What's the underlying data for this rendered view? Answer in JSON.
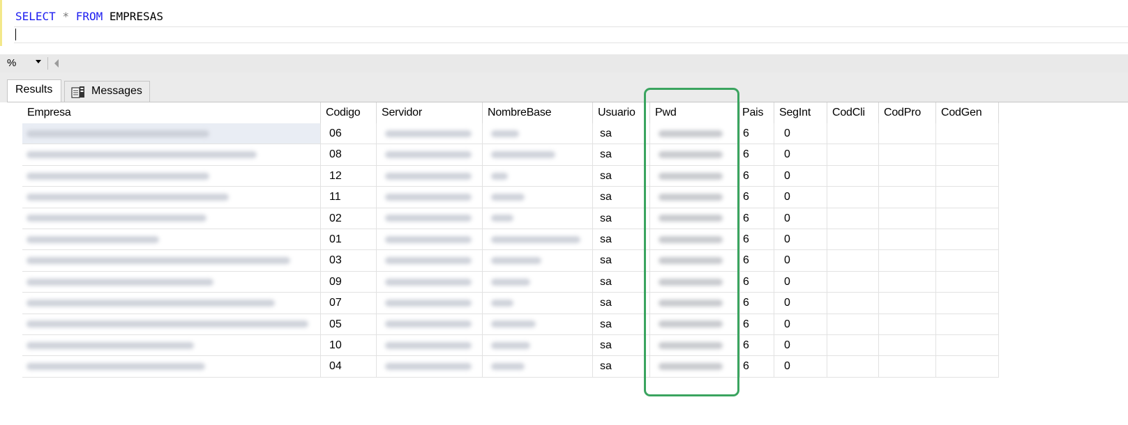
{
  "editor": {
    "keyword_select": "SELECT",
    "star": "*",
    "keyword_from": "FROM",
    "table_name": "EMPRESAS"
  },
  "zoom": {
    "value": "%"
  },
  "tabs": [
    {
      "label": "Results"
    },
    {
      "label": "Messages"
    }
  ],
  "grid": {
    "columns": [
      "Empresa",
      "Codigo",
      "Servidor",
      "NombreBase",
      "Usuario",
      "Pwd",
      "Pais",
      "SegInt",
      "CodCli",
      "CodPro",
      "CodGen"
    ],
    "rows": [
      {
        "codigo": "06",
        "usuario": "sa",
        "pais": "6",
        "segint": "0",
        "blur_w": [
          262,
          124,
          40
        ]
      },
      {
        "codigo": "08",
        "usuario": "sa",
        "pais": "6",
        "segint": "0",
        "blur_w": [
          330,
          124,
          92
        ]
      },
      {
        "codigo": "12",
        "usuario": "sa",
        "pais": "6",
        "segint": "0",
        "blur_w": [
          262,
          124,
          24
        ]
      },
      {
        "codigo": "11",
        "usuario": "sa",
        "pais": "6",
        "segint": "0",
        "blur_w": [
          290,
          124,
          48
        ]
      },
      {
        "codigo": "02",
        "usuario": "sa",
        "pais": "6",
        "segint": "0",
        "blur_w": [
          258,
          124,
          32
        ]
      },
      {
        "codigo": "01",
        "usuario": "sa",
        "pais": "6",
        "segint": "0",
        "blur_w": [
          190,
          124,
          128
        ]
      },
      {
        "codigo": "03",
        "usuario": "sa",
        "pais": "6",
        "segint": "0",
        "blur_w": [
          378,
          124,
          72
        ]
      },
      {
        "codigo": "09",
        "usuario": "sa",
        "pais": "6",
        "segint": "0",
        "blur_w": [
          268,
          124,
          56
        ]
      },
      {
        "codigo": "07",
        "usuario": "sa",
        "pais": "6",
        "segint": "0",
        "blur_w": [
          356,
          124,
          32
        ]
      },
      {
        "codigo": "05",
        "usuario": "sa",
        "pais": "6",
        "segint": "0",
        "blur_w": [
          404,
          124,
          64
        ]
      },
      {
        "codigo": "10",
        "usuario": "sa",
        "pais": "6",
        "segint": "0",
        "blur_w": [
          240,
          124,
          56
        ]
      },
      {
        "codigo": "04",
        "usuario": "sa",
        "pais": "6",
        "segint": "0",
        "blur_w": [
          256,
          124,
          48
        ]
      }
    ]
  },
  "colors": {
    "keyword": "#1d1df0",
    "highlight_border": "#3aa45f"
  }
}
